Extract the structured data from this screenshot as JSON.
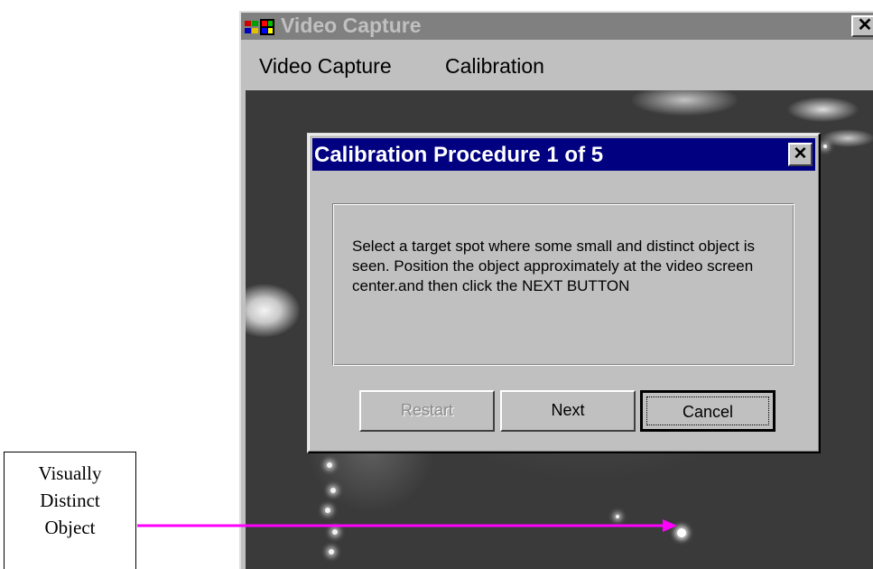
{
  "window": {
    "title": "Video Capture",
    "close_glyph": "✕",
    "icon": "windows-app-icon"
  },
  "menubar": {
    "items": [
      "Video Capture",
      "Calibration"
    ]
  },
  "dialog": {
    "title": "Calibration Procedure 1 of 5",
    "close_glyph": "✕",
    "message": "Select a target spot where some small and distinct object is seen. Position the object approximately at the video screen center.and then click the NEXT BUTTON",
    "buttons": {
      "restart": "Restart",
      "next": "Next",
      "cancel": "Cancel"
    },
    "title_bar_color": "#000080"
  },
  "annotation": {
    "lines": [
      "Visually",
      "Distinct",
      "Object"
    ],
    "arrow_color": "#ff00ff"
  }
}
